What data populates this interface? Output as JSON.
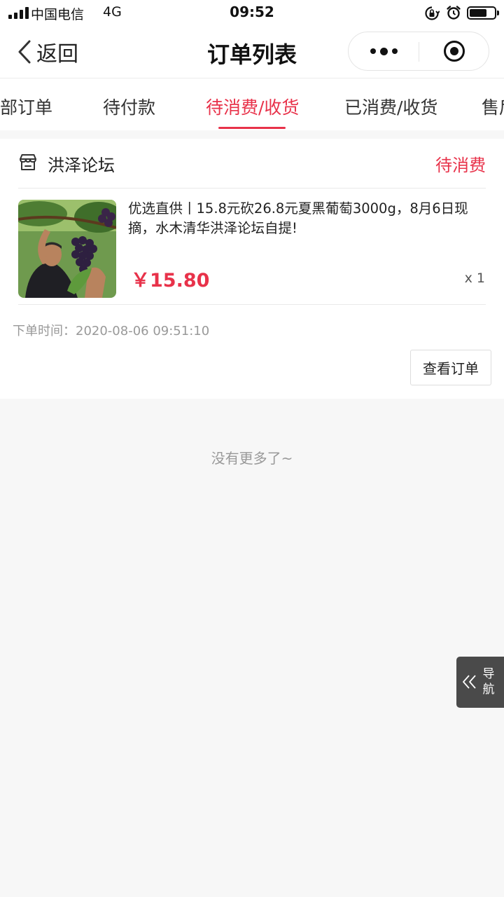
{
  "status_bar": {
    "carrier": "中国电信",
    "network": "4G",
    "time": "09:52",
    "icons": [
      "signal-icon",
      "orientation-lock-icon",
      "alarm-icon",
      "battery-icon"
    ]
  },
  "nav": {
    "back_label": "返回",
    "title": "订单列表",
    "icons": [
      "back-chevron-icon",
      "more-dots-icon",
      "close-target-icon"
    ]
  },
  "tabs": [
    {
      "label": "部订单",
      "active": false
    },
    {
      "label": "待付款",
      "active": false
    },
    {
      "label": "待消费/收货",
      "active": true
    },
    {
      "label": "已消费/收货",
      "active": false
    },
    {
      "label": "售后",
      "active": false
    }
  ],
  "order": {
    "shop_name": "洪泽论坛",
    "status": "待消费",
    "product_title": "优选直供丨15.8元砍26.8元夏黑葡萄3000g，8月6日现摘，水木清华洪泽论坛自提!",
    "price": "￥15.80",
    "quantity": "x 1",
    "order_time": "下单时间：2020-08-06 09:51:10",
    "view_button": "查看订单",
    "image_alt": "grape-farmer-photo"
  },
  "footer": {
    "no_more": "没有更多了~"
  },
  "float_nav": {
    "label": "导航",
    "icon": "double-chevron-left-icon"
  },
  "colors": {
    "accent": "#e8324a",
    "background": "#f7f7f7",
    "float_nav_bg": "#4a4a4a"
  }
}
